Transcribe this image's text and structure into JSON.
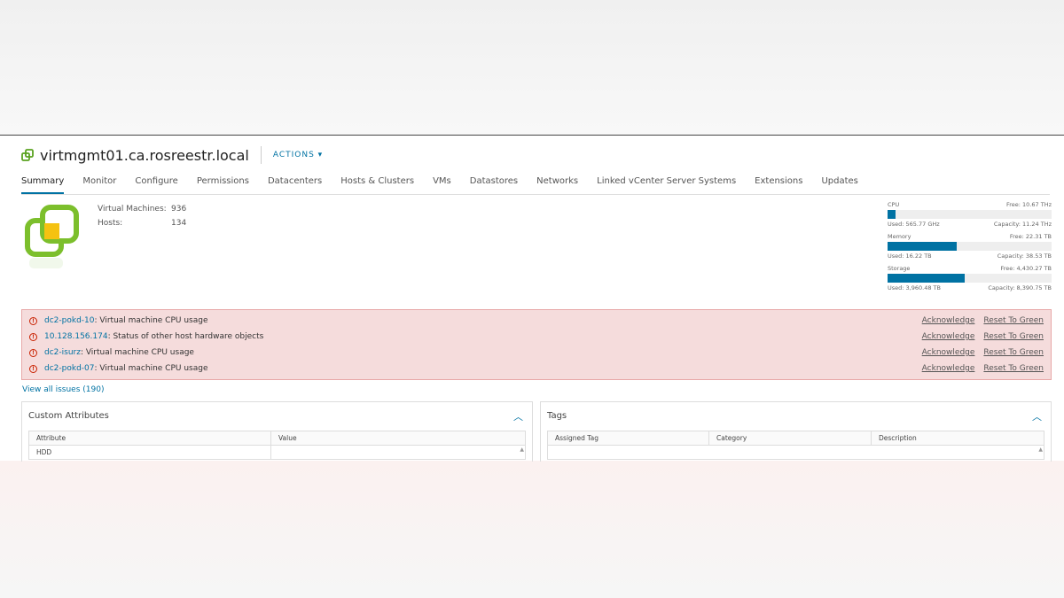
{
  "header": {
    "title": "virtmgmt01.ca.rosreestr.local",
    "actions": "ACTIONS ▾"
  },
  "tabs": [
    "Summary",
    "Monitor",
    "Configure",
    "Permissions",
    "Datacenters",
    "Hosts & Clusters",
    "VMs",
    "Datastores",
    "Networks",
    "Linked vCenter Server Systems",
    "Extensions",
    "Updates"
  ],
  "stats": {
    "vm_label": "Virtual Machines:",
    "vm_value": "936",
    "hosts_label": "Hosts:",
    "hosts_value": "134"
  },
  "resources": [
    {
      "name": "CPU",
      "free": "Free: 10.67 THz",
      "used": "Used: 565.77 GHz",
      "capacity": "Capacity: 11.24 THz",
      "percent": 5
    },
    {
      "name": "Memory",
      "free": "Free: 22.31 TB",
      "used": "Used: 16.22 TB",
      "capacity": "Capacity: 38.53 TB",
      "percent": 42
    },
    {
      "name": "Storage",
      "free": "Free: 4,430.27 TB",
      "used": "Used: 3,960.48 TB",
      "capacity": "Capacity: 8,390.75 TB",
      "percent": 47
    }
  ],
  "alerts": [
    {
      "object": "dc2-pokd-10",
      "message": ": Virtual machine CPU usage"
    },
    {
      "object": "10.128.156.174",
      "message": ": Status of other host hardware objects"
    },
    {
      "object": "dc2-isurz",
      "message": ": Virtual machine CPU usage"
    },
    {
      "object": "dc2-pokd-07",
      "message": ": Virtual machine CPU usage"
    }
  ],
  "alert_actions": {
    "ack": "Acknowledge",
    "reset": "Reset To Green"
  },
  "view_all": "View all issues (190)",
  "custom_attributes": {
    "title": "Custom Attributes",
    "columns": [
      "Attribute",
      "Value"
    ],
    "rows": [
      [
        "HDD",
        ""
      ]
    ]
  },
  "tags": {
    "title": "Tags",
    "columns": [
      "Assigned Tag",
      "Category",
      "Description"
    ]
  }
}
